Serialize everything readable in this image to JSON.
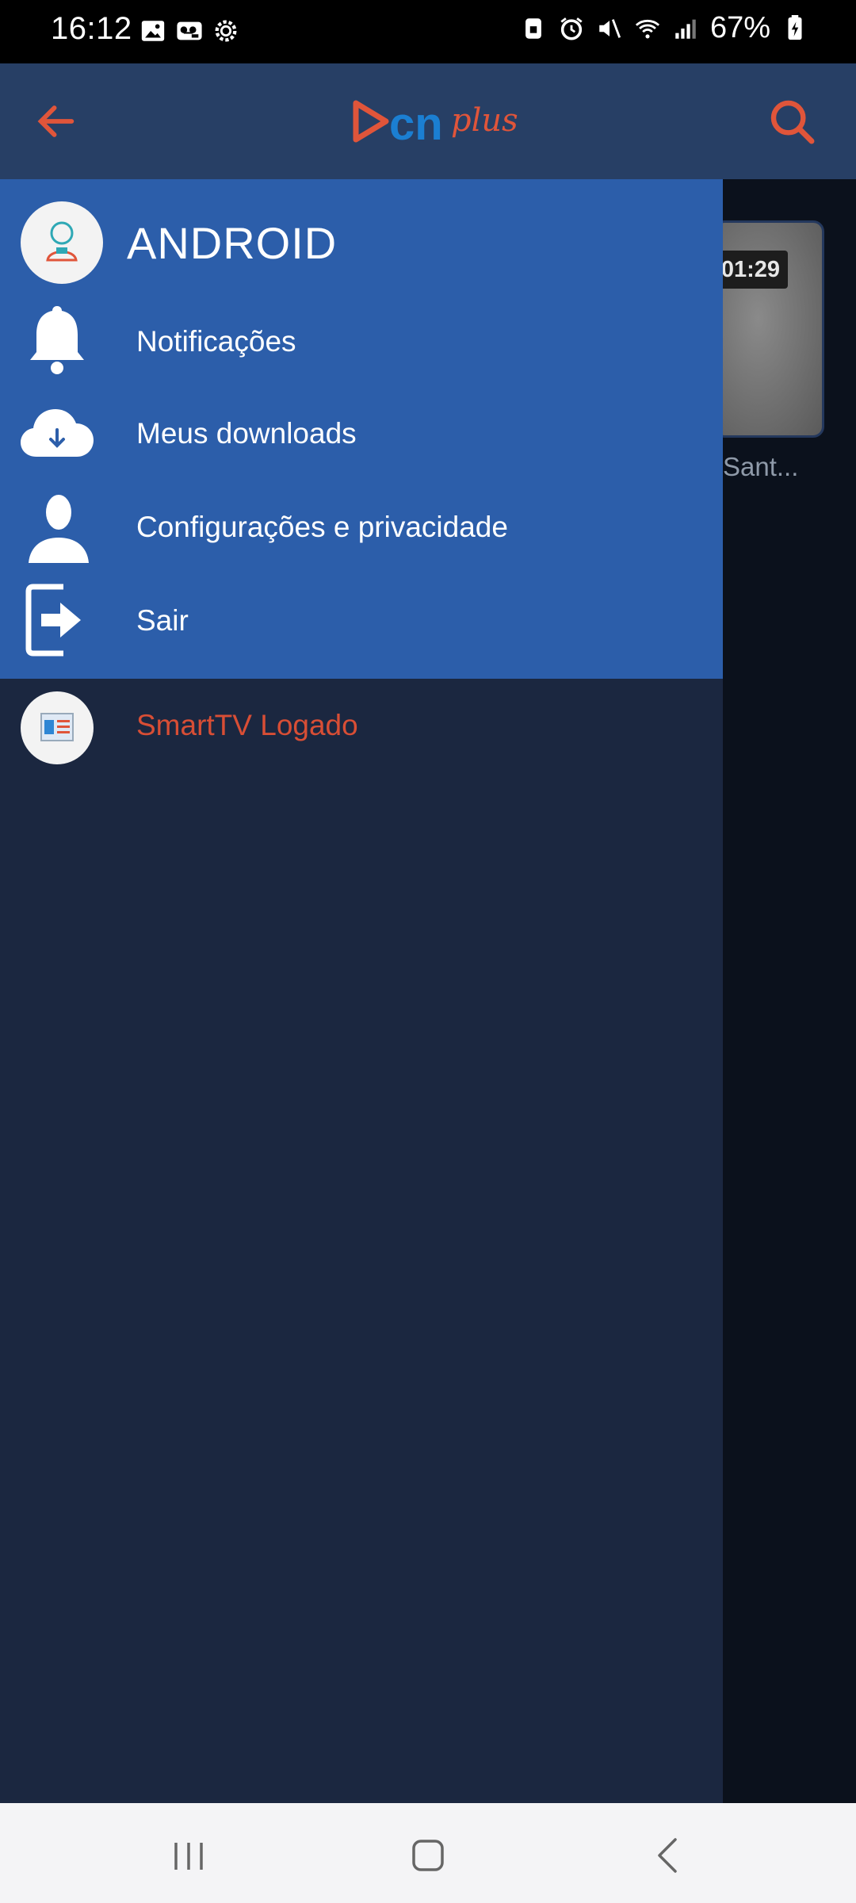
{
  "status_bar": {
    "time": "16:12",
    "battery": "67%",
    "left_icons": [
      "image-icon",
      "voicemail-icon",
      "settings-gear-icon"
    ],
    "right_icons": [
      "lock-screen-icon",
      "alarm-icon",
      "mute-icon",
      "wifi-icon",
      "signal-icon",
      "battery-icon"
    ]
  },
  "app_bar": {
    "back_icon": "arrow-left-icon",
    "logo_text_cn": "cn",
    "logo_text_plus": "plus",
    "search_icon": "search-icon",
    "accent_color": "#e0553a"
  },
  "background_content": {
    "duration": "01:29",
    "title": "Sant..."
  },
  "drawer": {
    "user_name": "ANDROID",
    "items": [
      {
        "label": "Notificações",
        "icon": "bell-icon"
      },
      {
        "label": "Meus downloads",
        "icon": "cloud-download-icon"
      },
      {
        "label": "Configurações e privacidade",
        "icon": "user-silhouette-icon"
      },
      {
        "label": "Sair",
        "icon": "logout-icon"
      }
    ],
    "smarttv_label": "SmartTV Logado",
    "header_color": "#2c5eaa",
    "body_color": "#1b2740"
  },
  "nav_bar": {
    "recents": "recents-icon",
    "home": "home-icon",
    "back": "back-icon"
  }
}
